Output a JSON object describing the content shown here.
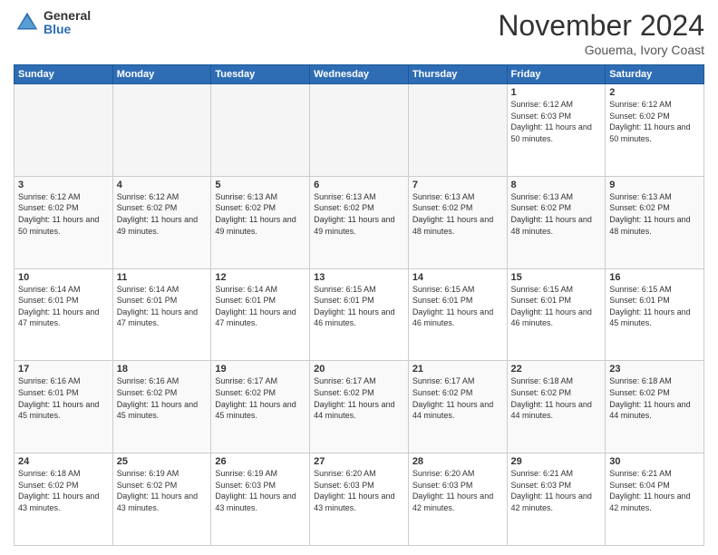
{
  "header": {
    "logo_general": "General",
    "logo_blue": "Blue",
    "month_title": "November 2024",
    "location": "Gouema, Ivory Coast"
  },
  "calendar": {
    "days_of_week": [
      "Sunday",
      "Monday",
      "Tuesday",
      "Wednesday",
      "Thursday",
      "Friday",
      "Saturday"
    ],
    "weeks": [
      [
        {
          "day": "",
          "empty": true
        },
        {
          "day": "",
          "empty": true
        },
        {
          "day": "",
          "empty": true
        },
        {
          "day": "",
          "empty": true
        },
        {
          "day": "",
          "empty": true
        },
        {
          "day": "1",
          "sunrise": "6:12 AM",
          "sunset": "6:03 PM",
          "daylight": "11 hours and 50 minutes."
        },
        {
          "day": "2",
          "sunrise": "6:12 AM",
          "sunset": "6:02 PM",
          "daylight": "11 hours and 50 minutes."
        }
      ],
      [
        {
          "day": "3",
          "sunrise": "6:12 AM",
          "sunset": "6:02 PM",
          "daylight": "11 hours and 50 minutes."
        },
        {
          "day": "4",
          "sunrise": "6:12 AM",
          "sunset": "6:02 PM",
          "daylight": "11 hours and 49 minutes."
        },
        {
          "day": "5",
          "sunrise": "6:13 AM",
          "sunset": "6:02 PM",
          "daylight": "11 hours and 49 minutes."
        },
        {
          "day": "6",
          "sunrise": "6:13 AM",
          "sunset": "6:02 PM",
          "daylight": "11 hours and 49 minutes."
        },
        {
          "day": "7",
          "sunrise": "6:13 AM",
          "sunset": "6:02 PM",
          "daylight": "11 hours and 48 minutes."
        },
        {
          "day": "8",
          "sunrise": "6:13 AM",
          "sunset": "6:02 PM",
          "daylight": "11 hours and 48 minutes."
        },
        {
          "day": "9",
          "sunrise": "6:13 AM",
          "sunset": "6:02 PM",
          "daylight": "11 hours and 48 minutes."
        }
      ],
      [
        {
          "day": "10",
          "sunrise": "6:14 AM",
          "sunset": "6:01 PM",
          "daylight": "11 hours and 47 minutes."
        },
        {
          "day": "11",
          "sunrise": "6:14 AM",
          "sunset": "6:01 PM",
          "daylight": "11 hours and 47 minutes."
        },
        {
          "day": "12",
          "sunrise": "6:14 AM",
          "sunset": "6:01 PM",
          "daylight": "11 hours and 47 minutes."
        },
        {
          "day": "13",
          "sunrise": "6:15 AM",
          "sunset": "6:01 PM",
          "daylight": "11 hours and 46 minutes."
        },
        {
          "day": "14",
          "sunrise": "6:15 AM",
          "sunset": "6:01 PM",
          "daylight": "11 hours and 46 minutes."
        },
        {
          "day": "15",
          "sunrise": "6:15 AM",
          "sunset": "6:01 PM",
          "daylight": "11 hours and 46 minutes."
        },
        {
          "day": "16",
          "sunrise": "6:15 AM",
          "sunset": "6:01 PM",
          "daylight": "11 hours and 45 minutes."
        }
      ],
      [
        {
          "day": "17",
          "sunrise": "6:16 AM",
          "sunset": "6:01 PM",
          "daylight": "11 hours and 45 minutes."
        },
        {
          "day": "18",
          "sunrise": "6:16 AM",
          "sunset": "6:02 PM",
          "daylight": "11 hours and 45 minutes."
        },
        {
          "day": "19",
          "sunrise": "6:17 AM",
          "sunset": "6:02 PM",
          "daylight": "11 hours and 45 minutes."
        },
        {
          "day": "20",
          "sunrise": "6:17 AM",
          "sunset": "6:02 PM",
          "daylight": "11 hours and 44 minutes."
        },
        {
          "day": "21",
          "sunrise": "6:17 AM",
          "sunset": "6:02 PM",
          "daylight": "11 hours and 44 minutes."
        },
        {
          "day": "22",
          "sunrise": "6:18 AM",
          "sunset": "6:02 PM",
          "daylight": "11 hours and 44 minutes."
        },
        {
          "day": "23",
          "sunrise": "6:18 AM",
          "sunset": "6:02 PM",
          "daylight": "11 hours and 44 minutes."
        }
      ],
      [
        {
          "day": "24",
          "sunrise": "6:18 AM",
          "sunset": "6:02 PM",
          "daylight": "11 hours and 43 minutes."
        },
        {
          "day": "25",
          "sunrise": "6:19 AM",
          "sunset": "6:02 PM",
          "daylight": "11 hours and 43 minutes."
        },
        {
          "day": "26",
          "sunrise": "6:19 AM",
          "sunset": "6:03 PM",
          "daylight": "11 hours and 43 minutes."
        },
        {
          "day": "27",
          "sunrise": "6:20 AM",
          "sunset": "6:03 PM",
          "daylight": "11 hours and 43 minutes."
        },
        {
          "day": "28",
          "sunrise": "6:20 AM",
          "sunset": "6:03 PM",
          "daylight": "11 hours and 42 minutes."
        },
        {
          "day": "29",
          "sunrise": "6:21 AM",
          "sunset": "6:03 PM",
          "daylight": "11 hours and 42 minutes."
        },
        {
          "day": "30",
          "sunrise": "6:21 AM",
          "sunset": "6:04 PM",
          "daylight": "11 hours and 42 minutes."
        }
      ]
    ]
  }
}
